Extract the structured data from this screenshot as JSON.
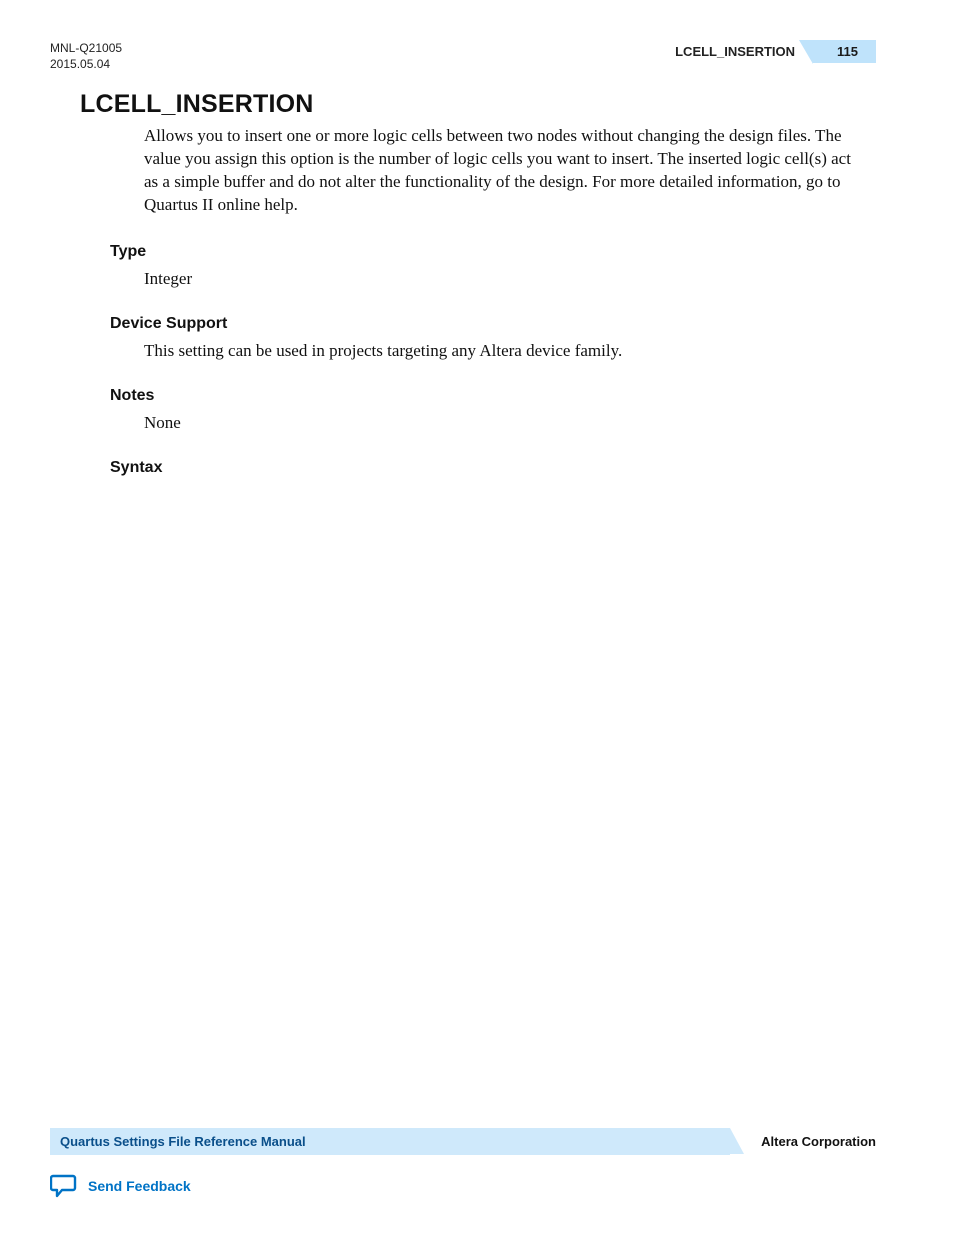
{
  "header": {
    "doc_id": "MNL-Q21005",
    "date": "2015.05.04",
    "title_right": "LCELL_INSERTION",
    "page_number": "115"
  },
  "main": {
    "heading": "LCELL_INSERTION",
    "intro": "Allows you to insert one or more logic cells between two nodes without changing the design files. The value you assign this option is the number of logic cells you want to insert. The inserted logic cell(s) act as a simple buffer and do not alter the functionality of the design. For more detailed information, go to Quartus II online help.",
    "sections": {
      "type": {
        "title": "Type",
        "body": "Integer"
      },
      "device_support": {
        "title": "Device Support",
        "body": "This setting can be used in projects targeting any Altera device family."
      },
      "notes": {
        "title": "Notes",
        "body": "None"
      },
      "syntax": {
        "title": "Syntax"
      }
    }
  },
  "footer": {
    "manual_title": "Quartus Settings File Reference Manual",
    "company": "Altera Corporation",
    "feedback": "Send Feedback"
  }
}
